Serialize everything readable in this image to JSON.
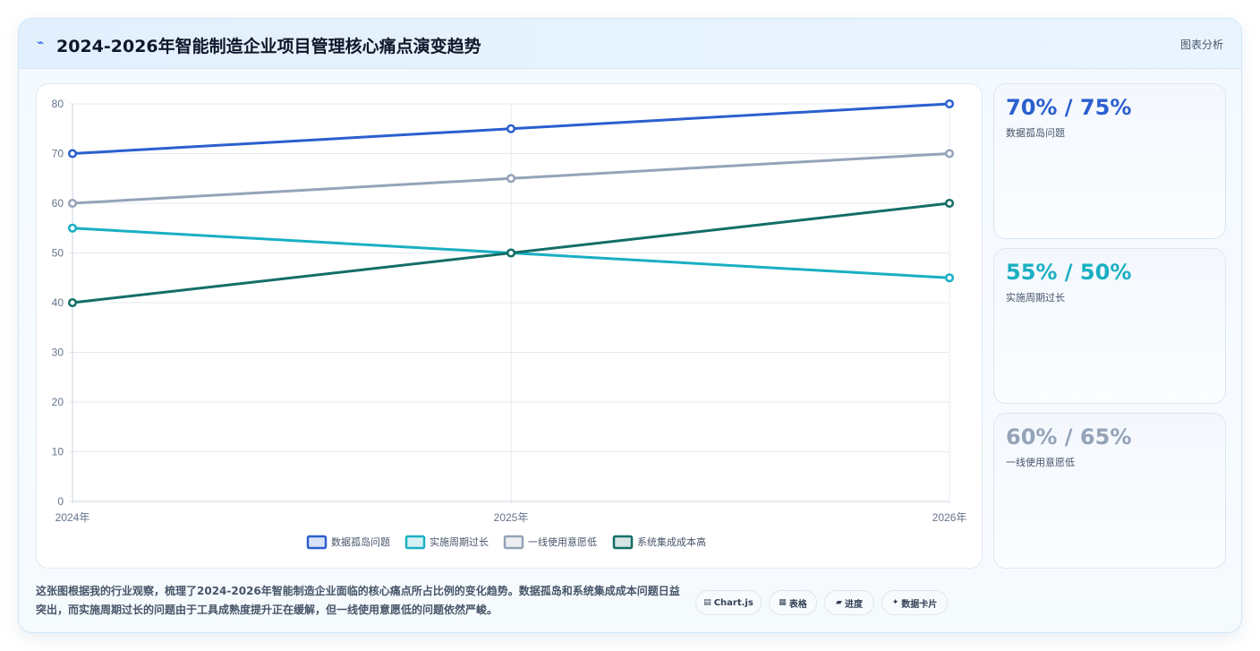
{
  "header": {
    "icon": "trend-icon",
    "title": "2024-2026年智能制造企业项目管理核心痛点演变趋势",
    "action": "图表分析"
  },
  "colors": {
    "series1": "#2b5fcf",
    "series2": "#1aafc3",
    "series3": "#94a3b8",
    "series4": "#146e66"
  },
  "chart_data": {
    "type": "line",
    "x": [
      "2024年",
      "2025年",
      "2026年"
    ],
    "ylim": [
      0,
      80
    ],
    "yticks": [
      0,
      10,
      20,
      30,
      40,
      50,
      60,
      70,
      80
    ],
    "grid": true,
    "legend_position": "bottom",
    "title": "",
    "xlabel": "",
    "ylabel": "",
    "series": [
      {
        "name": "数据孤岛问题",
        "values": [
          70,
          75,
          80
        ],
        "color": "#2b5fcf"
      },
      {
        "name": "实施周期过长",
        "values": [
          55,
          50,
          45
        ],
        "color": "#1aafc3"
      },
      {
        "name": "一线使用意愿低",
        "values": [
          60,
          65,
          70
        ],
        "color": "#94a3b8"
      },
      {
        "name": "系统集成成本高",
        "values": [
          40,
          50,
          60
        ],
        "color": "#146e66"
      }
    ]
  },
  "stats": [
    {
      "value": "70% / 75%",
      "label": "数据孤岛问题",
      "color": "#2b5fcf"
    },
    {
      "value": "55% / 50%",
      "label": "实施周期过长",
      "color": "#1aafc3"
    },
    {
      "value": "60% / 65%",
      "label": "一线使用意愿低",
      "color": "#94a3b8"
    }
  ],
  "description": "这张图根据我的行业观察，梳理了2024-2026年智能制造企业面临的核心痛点所占比例的变化趋势。数据孤岛和系统集成成本问题日益突出，而实施周期过长的问题由于工具成熟度提升正在缓解，但一线使用意愿低的问题依然严峻。",
  "chips": [
    {
      "icon": "chart-icon",
      "glyph": "▤",
      "label": "Chart.js"
    },
    {
      "icon": "table-icon",
      "glyph": "▦",
      "label": "表格"
    },
    {
      "icon": "progress-icon",
      "glyph": "▰",
      "label": "进度"
    },
    {
      "icon": "card-icon",
      "glyph": "✦",
      "label": "数据卡片"
    }
  ]
}
